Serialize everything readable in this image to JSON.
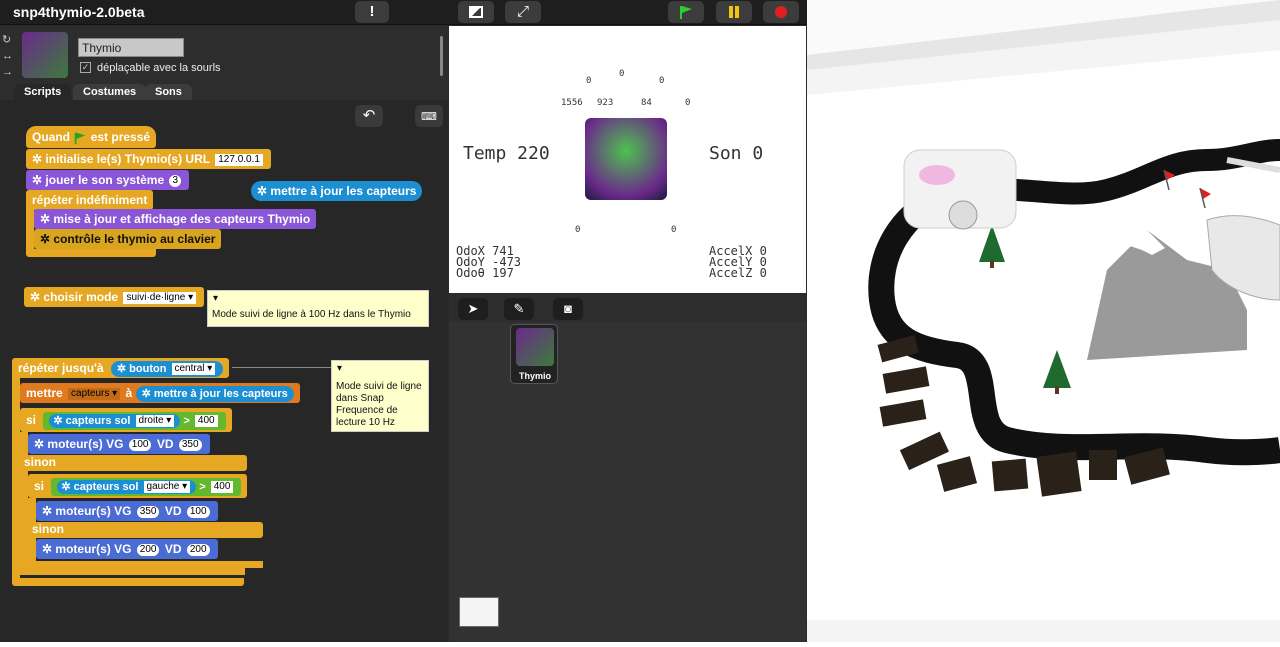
{
  "app": {
    "title": "snp4thymio-2.0beta"
  },
  "toolbar": {
    "settings_icon": "!",
    "stage_size_icon": "stage-size-icon",
    "fullscreen_icon": "fullscreen-icon",
    "colors": {
      "flag": "#2ecc2e",
      "pause": "#f1c40f",
      "stop": "#e02020"
    }
  },
  "sprite": {
    "name": "Thymio",
    "draggable_label": "déplaçable avec la sourls",
    "draggable_checked": "✓"
  },
  "tabs": [
    {
      "label": "Scripts"
    },
    {
      "label": "Costumes"
    },
    {
      "label": "Sons"
    }
  ],
  "scripts": {
    "hat_when": "Quand",
    "hat_pressed": "est pressé",
    "init_label": "initialise le(s) Thymio(s) URL",
    "init_url": "127.0.0.1",
    "play_sound_label": "jouer le son système",
    "play_sound_value": "3",
    "forever_label": "répéter indéfiniment",
    "update_display_label": "mise à jour et affichage des capteurs Thymio",
    "keyboard_control_label": "contrôle le thymio au clavier",
    "floating_update_label": "mettre à jour les capteurs",
    "choose_mode_label": "choisir mode",
    "choose_mode_value": "suivi·de·ligne",
    "comment_1": "Mode suivi de ligne à 100 Hz dans le Thymio",
    "repeat_until_label": "répéter jusqu'à",
    "button_label": "bouton",
    "button_value": "central",
    "set_label": "mettre",
    "set_var": "capteurs",
    "set_to": "à",
    "set_update_label": "mettre à jour les capteurs",
    "if_label": "si",
    "floor_sensor_label": "capteurs sol",
    "right_value": "droite",
    "gt": ">",
    "threshold_1": "400",
    "motors_label": "moteur(s)",
    "vg": "VG",
    "vd": "VD",
    "motor1_vg": "100",
    "motor1_vd": "350",
    "else_label": "sinon",
    "left_value": "gauche",
    "threshold_2": "400",
    "motor2_vg": "350",
    "motor2_vd": "100",
    "motor3_vg": "200",
    "motor3_vd": "200",
    "comment_2": "Mode suivi de ligne dans Snap Frequence de lecture 10 Hz"
  },
  "stage": {
    "temp": "Temp 220",
    "son": "Son 0",
    "prox_top": [
      "0",
      "0",
      "0"
    ],
    "prox_row": [
      "1556",
      "923",
      "84",
      "0"
    ],
    "ground": [
      "0",
      "0"
    ],
    "odox": "OdoX 741",
    "odoy": "OdoY -473",
    "odot": "Odoθ 197",
    "accelx": "AccelX 0",
    "accely": "AccelY 0",
    "accelz": "AccelZ 0"
  },
  "corral": {
    "sprite_label": "Thymio"
  }
}
